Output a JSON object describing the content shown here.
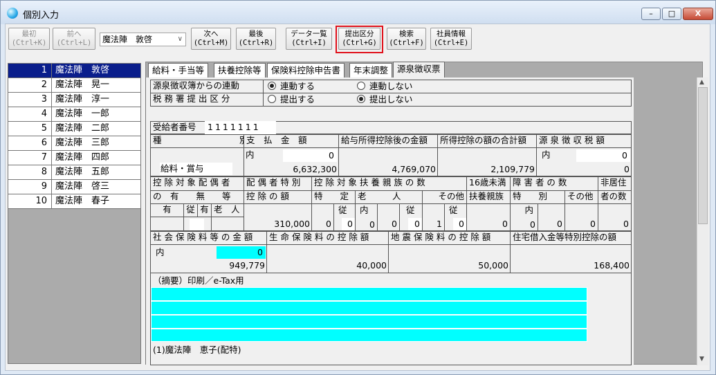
{
  "window": {
    "title": "個別入力",
    "min": "–",
    "max": "□",
    "close": "X"
  },
  "toolbar": {
    "first": "最初\n(Ctrl+K)",
    "prev": "前へ\n(Ctrl+L)",
    "employee_select": "魔法陣　敦啓",
    "next": "次へ\n(Ctrl+M)",
    "last": "最後\n(Ctrl+R)",
    "data_list": "データ一覧\n(Ctrl+I)",
    "submit_category": "提出区分\n(Ctrl+G)",
    "search": "検索\n(Ctrl+F)",
    "employee_info": "社員情報\n(Ctrl+E)"
  },
  "employees": [
    {
      "no": "1",
      "name": "魔法陣　敦啓"
    },
    {
      "no": "2",
      "name": "魔法陣　晃一"
    },
    {
      "no": "3",
      "name": "魔法陣　淳一"
    },
    {
      "no": "4",
      "name": "魔法陣　一郎"
    },
    {
      "no": "5",
      "name": "魔法陣　二郎"
    },
    {
      "no": "6",
      "name": "魔法陣　三郎"
    },
    {
      "no": "7",
      "name": "魔法陣　四郎"
    },
    {
      "no": "8",
      "name": "魔法陣　五郎"
    },
    {
      "no": "9",
      "name": "魔法陣　啓三"
    },
    {
      "no": "10",
      "name": "魔法陣　春子"
    }
  ],
  "tabs": [
    "給料・手当等",
    "扶養控除等",
    "保険料控除申告書",
    "年末調整",
    "源泉徴収票"
  ],
  "form": {
    "link_label": "源泉徴収簿からの連動",
    "link_on": "連動する",
    "link_off": "連動しない",
    "office_label": "税 務 署 提 出 区 分",
    "office_on": "提出する",
    "office_off": "提出しない",
    "recipient_label": "受給者番号",
    "recipient_no": "1111111",
    "h_kind": "種　　　　　　　　　別",
    "h_pay": "支　払　金　額",
    "h_after": "給与所得控除後の金額",
    "h_total": "所得控除の額の合計額",
    "h_tax": "源 泉 徴 収 税 額",
    "in1": "内",
    "in2": "内",
    "pay_inner": "0",
    "tax_inner": "0",
    "kind": "給料・賞与",
    "pay": "6,632,300",
    "after": "4,769,070",
    "total": "2,109,779",
    "tax": "0",
    "h_spouse": "控 除 対 象 配 偶 者",
    "h_spouse2": "の　有　　無　　等",
    "h_spec": "配 偶 者 特 別",
    "h_spec2": "控 除 の 額",
    "h_dep": "控 除 対 象 扶 養 親 族 の 数",
    "h_toku": "特　　定",
    "h_rou": "老　　　人",
    "h_other": "その他",
    "h_u16": "16歳未満",
    "h_u16b": "扶養親族",
    "h_dis": "障 害 者 の 数",
    "h_dis_t": "特　　別",
    "h_dis_o": "その他",
    "h_nonres": "非居住",
    "h_nonres2": "者の数",
    "s_yes": "有",
    "s_ju": "従",
    "s_yes2": "有",
    "s_old": "老　人",
    "spec_amt": "310,000",
    "toku_v": "0",
    "ju1": "従",
    "toku_ju": "0",
    "nai1": "内",
    "rou_v": "0",
    "rou_b": "0",
    "ju2": "従",
    "rou_ju": "0",
    "other_v": "1",
    "ju3": "従",
    "other_ju": "0",
    "u16_v": "0",
    "nai2": "内",
    "dis_in": "0",
    "dis_t": "0",
    "dis_o": "0",
    "nonres": "0",
    "h_social": "社 会 保 険 料 等 の 金 額",
    "h_life": "生 命 保 険 料 の 控 除 額",
    "h_quake": "地 震 保 険 料 の 控 除 額",
    "h_house": "住宅借入金等特別控除の額",
    "social_in_label": "内",
    "social_in": "0",
    "social": "949,779",
    "life": "40,000",
    "quake": "50,000",
    "house": "168,400",
    "memo_label": "（摘要）印刷／e-Tax用",
    "memo_note": "(1)魔法陣　恵子(配特)"
  }
}
